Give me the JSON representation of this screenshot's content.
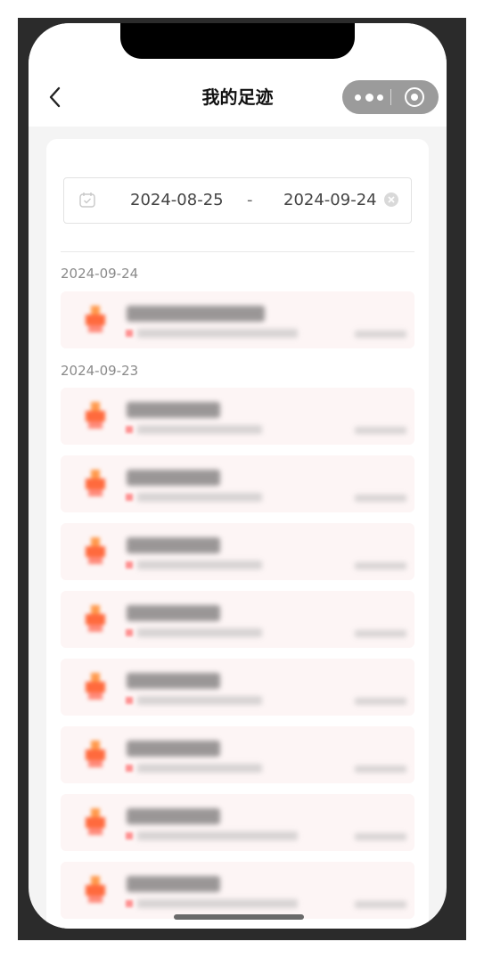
{
  "header": {
    "title": "我的足迹",
    "back_icon": "chevron-left-icon",
    "more_icon": "more-dots-icon",
    "close_icon": "target-circle-icon"
  },
  "date_filter": {
    "start_date": "2024-08-25",
    "separator": "-",
    "end_date": "2024-09-24",
    "calendar_icon": "calendar-icon",
    "clear_icon": "clear-circle-icon"
  },
  "groups": [
    {
      "date": "2024-09-24",
      "items": [
        {
          "thumbnail": "blurred"
        }
      ]
    },
    {
      "date": "2024-09-23",
      "items": [
        {
          "thumbnail": "blurred"
        },
        {
          "thumbnail": "blurred"
        },
        {
          "thumbnail": "blurred"
        },
        {
          "thumbnail": "blurred"
        },
        {
          "thumbnail": "blurred"
        },
        {
          "thumbnail": "blurred"
        },
        {
          "thumbnail": "blurred"
        },
        {
          "thumbnail": "blurred"
        }
      ]
    }
  ],
  "colors": {
    "item_bg": "#fdf5f5",
    "accent": "#ff6a3d"
  }
}
